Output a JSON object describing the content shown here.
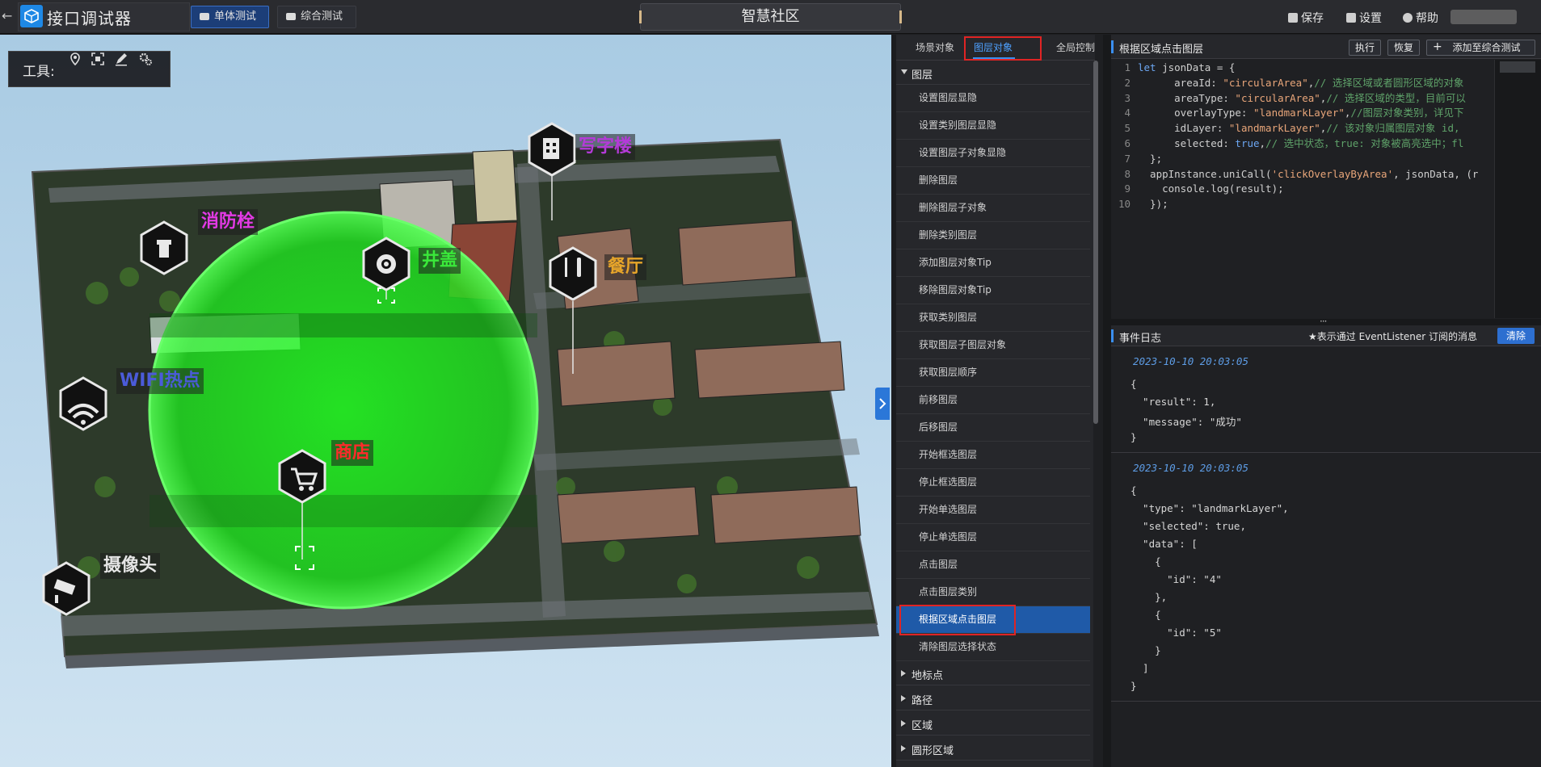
{
  "app": {
    "title": "接口调试器",
    "center_title": "智慧社区"
  },
  "top": {
    "modes": [
      "单体测试",
      "综合测试"
    ],
    "actions": {
      "save": "保存",
      "settings": "设置",
      "help": "帮助"
    }
  },
  "scene": {
    "toolbar_label": "工具:",
    "tool_icons": [
      "location-pin-icon",
      "focus-frame-icon",
      "pen-icon",
      "settings-gear-icon"
    ],
    "poi": {
      "office": "写字楼",
      "hydrant": "消防栓",
      "manhole": "井盖",
      "restaurant": "餐厅",
      "wifi": "WIFI热点",
      "shop": "商店",
      "camera": "摄像头"
    },
    "colors": {
      "selection_circle": "#2bff2b",
      "wifi_label": "#4b5bd9",
      "hydrant_label": "#e33ae5",
      "office_label": "#b43ad8",
      "shop_label": "#ff2b2b",
      "restaurant_label": "#e7a52a",
      "manhole_label": "#3ae83a",
      "camera_label": "#e6e6e6"
    }
  },
  "tree": {
    "tabs": [
      "场景对象",
      "图层对象",
      "全局控制"
    ],
    "active_tab": "图层对象",
    "group_open": "图层",
    "items": [
      "设置图层显隐",
      "设置类别图层显隐",
      "设置图层子对象显隐",
      "删除图层",
      "删除图层子对象",
      "删除类别图层",
      "添加图层对象Tip",
      "移除图层对象Tip",
      "获取类别图层",
      "获取图层子图层对象",
      "获取图层顺序",
      "前移图层",
      "后移图层",
      "开始框选图层",
      "停止框选图层",
      "开始单选图层",
      "停止单选图层",
      "点击图层",
      "点击图层类别",
      "根据区域点击图层",
      "清除图层选择状态"
    ],
    "selected_item": "根据区域点击图层",
    "groups_closed": [
      "地标点",
      "路径",
      "区域",
      "圆形区域"
    ]
  },
  "editor": {
    "title": "根据区域点击图层",
    "buttons": {
      "run": "执行",
      "restore": "恢复",
      "add": "添加至综合测试"
    },
    "line_numbers": [
      "1",
      "2",
      "3",
      "4",
      "5",
      "6",
      "7",
      "8",
      "9",
      "10"
    ]
  },
  "code_lines": [
    {
      "t": [
        [
          "kw",
          "let "
        ],
        [
          "fn",
          "jsonData = {"
        ]
      ]
    },
    {
      "t": [
        [
          "fn",
          "      areaId: "
        ],
        [
          "str",
          "\"circularArea\""
        ],
        [
          "fn",
          ","
        ],
        [
          "cm",
          "// 选择区域或者圆形区域的对象"
        ]
      ]
    },
    {
      "t": [
        [
          "fn",
          "      areaType: "
        ],
        [
          "str",
          "\"circularArea\""
        ],
        [
          "fn",
          ","
        ],
        [
          "cm",
          "// 选择区域的类型，目前可以"
        ]
      ]
    },
    {
      "t": [
        [
          "fn",
          "      overlayType: "
        ],
        [
          "str",
          "\"landmarkLayer\""
        ],
        [
          "fn",
          ","
        ],
        [
          "cm",
          "//图层对象类别，详见下"
        ]
      ]
    },
    {
      "t": [
        [
          "fn",
          "      idLayer: "
        ],
        [
          "str",
          "\"landmarkLayer\""
        ],
        [
          "fn",
          ","
        ],
        [
          "cm",
          "// 该对象归属图层对象 id,"
        ]
      ]
    },
    {
      "t": [
        [
          "fn",
          "      selected: "
        ],
        [
          "bl",
          "true"
        ],
        [
          "fn",
          ","
        ],
        [
          "cm",
          "// 选中状态，true: 对象被高亮选中；fl"
        ]
      ]
    },
    {
      "t": [
        [
          "fn",
          "  };"
        ]
      ]
    },
    {
      "t": [
        [
          "fn",
          "  appInstance.uniCall("
        ],
        [
          "str",
          "'clickOverlayByArea'"
        ],
        [
          "fn",
          ", jsonData, (r"
        ]
      ]
    },
    {
      "t": [
        [
          "fn",
          "    console.log(result);"
        ]
      ]
    },
    {
      "t": [
        [
          "fn",
          "  });"
        ]
      ]
    }
  ],
  "log": {
    "title": "事件日志",
    "note": "★表示通过 EventListener 订阅的消息",
    "clear": "清除",
    "entries": [
      {
        "time": "2023-10-10 20:03:05",
        "lines": [
          "{",
          "  \"result\": 1,",
          "  \"message\": \"成功\"",
          "}"
        ]
      },
      {
        "time": "2023-10-10 20:03:05",
        "lines": [
          "{",
          "  \"type\": \"landmarkLayer\",",
          "  \"selected\": true,",
          "  \"data\": [",
          "    {",
          "      \"id\": \"4\"",
          "    },",
          "    {",
          "      \"id\": \"5\"",
          "    }",
          "  ]",
          "}"
        ]
      }
    ]
  }
}
